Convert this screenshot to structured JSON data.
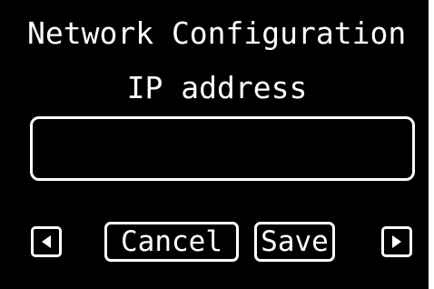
{
  "screen": {
    "title": "Network Configuration",
    "subtitle": "IP address"
  },
  "ip_field": {
    "value": "",
    "placeholder": ""
  },
  "buttons": {
    "cancel_label": "Cancel",
    "save_label": "Save",
    "prev_icon": "left-triangle-icon",
    "next_icon": "right-triangle-icon"
  },
  "colors": {
    "background": "#000000",
    "foreground": "#ffffff"
  }
}
